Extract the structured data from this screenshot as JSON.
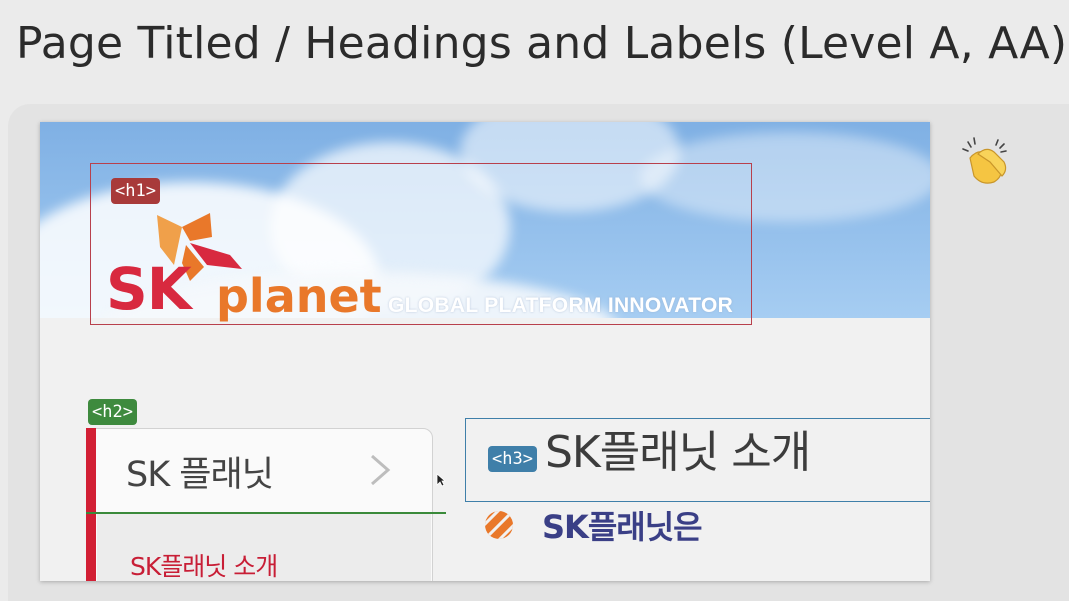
{
  "slide": {
    "title": "Page Titled / Headings and Labels (Level A, AA)"
  },
  "screenshot": {
    "tags": {
      "h1": "<h1>",
      "h2": "<h2>",
      "h3": "<h3>"
    },
    "logo": {
      "sk": "SK",
      "planet": "planet",
      "tagline": "GLOBAL PLATFORM INNOVATOR"
    },
    "nav": {
      "main_item": "SK 플래닛",
      "sub_item": "SK플래닛 소개"
    },
    "content": {
      "heading": "SK플래닛 소개",
      "subheading": "SK플래닛은"
    }
  },
  "icons": [
    "clapping-hands-icon",
    "chevron-right-icon",
    "butterfly-logo-icon",
    "striped-circle-icon",
    "mouse-cursor-icon"
  ],
  "colors": {
    "h1_tag": "#a83a3a",
    "h2_tag": "#3e8a3e",
    "h3_tag": "#3f7fa9",
    "brand_red": "#d8293f",
    "brand_orange": "#e9782a",
    "nav_red": "#d21f34"
  }
}
